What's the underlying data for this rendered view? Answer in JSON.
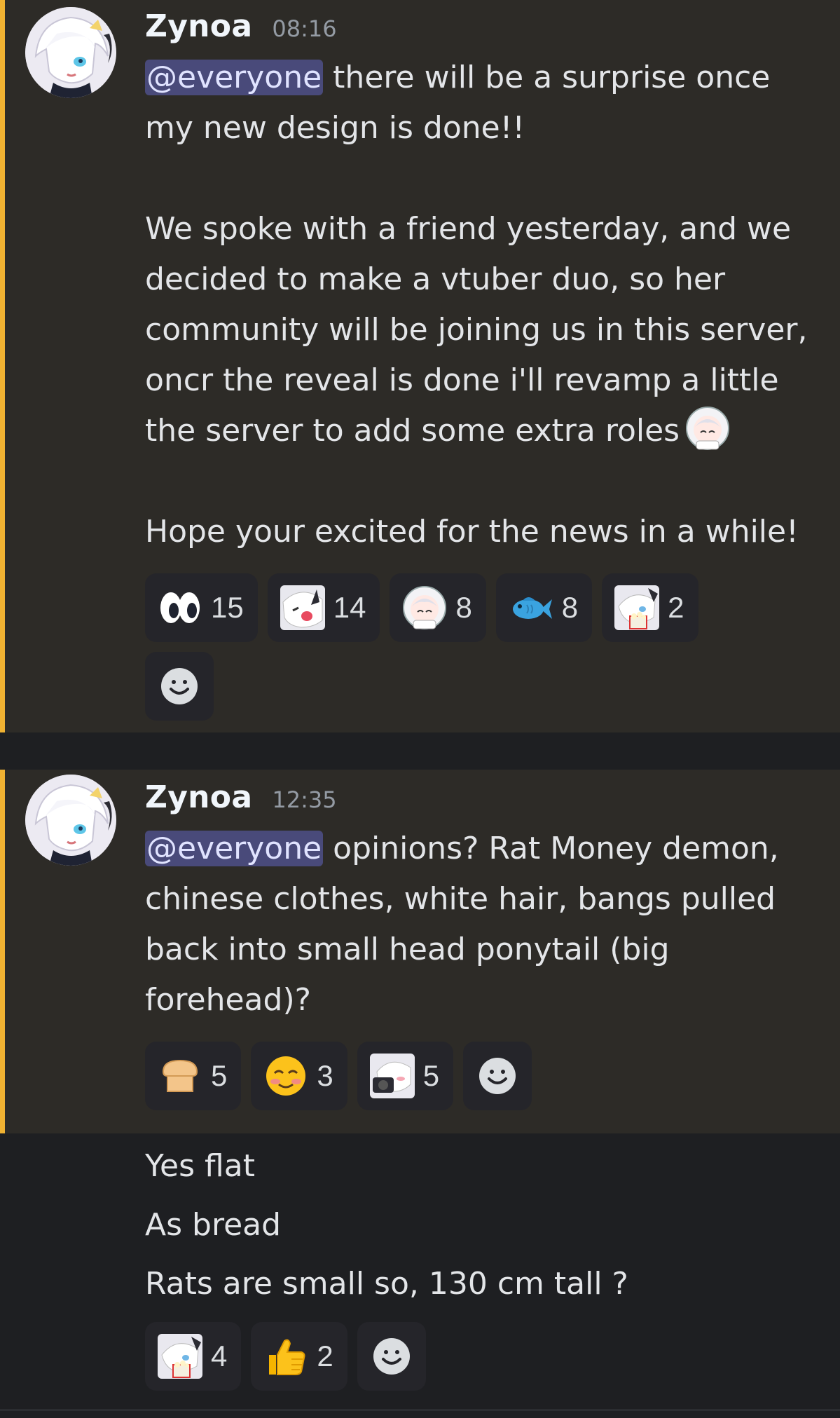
{
  "messages": [
    {
      "username": "Zynoa",
      "time": "08:16",
      "mention": "@everyone",
      "line1_rest": " there will be a surprise once my new design is done!!",
      "paragraph2": "We spoke with a friend yesterday, and we decided to make a vtuber duo, so her community will be joining us in this server, oncr the reveal is done i'll revamp a little the server to add some extra roles",
      "paragraph3": "Hope your excited for the news in a while!",
      "reactions": [
        {
          "emoji": "eyes-icon",
          "count": "15"
        },
        {
          "emoji": "anime-girl-crying-emoji",
          "count": "14"
        },
        {
          "emoji": "anime-girl-astronaut-emoji",
          "count": "8"
        },
        {
          "emoji": "fish-icon",
          "count": "8"
        },
        {
          "emoji": "anime-girl-popcorn-emoji",
          "count": "2"
        }
      ]
    },
    {
      "username": "Zynoa",
      "time": "12:35",
      "mention": "@everyone",
      "line_rest": " opinions? Rat Money demon, chinese clothes, white hair, bangs pulled back into small head ponytail (big forehead)?",
      "reactions": [
        {
          "emoji": "bread-icon",
          "count": "5"
        },
        {
          "emoji": "smiling-blushing-face-icon",
          "count": "3"
        },
        {
          "emoji": "anime-girl-camera-emoji",
          "count": "5"
        }
      ]
    }
  ],
  "followups": [
    "Yes flat",
    "As bread",
    "Rats are small so, 130 cm tall ?"
  ],
  "followup_reactions": [
    {
      "emoji": "anime-girl-popcorn-emoji",
      "count": "4"
    },
    {
      "emoji": "thumbs-up-icon",
      "count": "2"
    }
  ],
  "colors": {
    "highlight_bar": "#f0b232",
    "highlight_bg": "#2d2b27",
    "mention_bg": "#494a7a",
    "background": "#1e1f22"
  }
}
